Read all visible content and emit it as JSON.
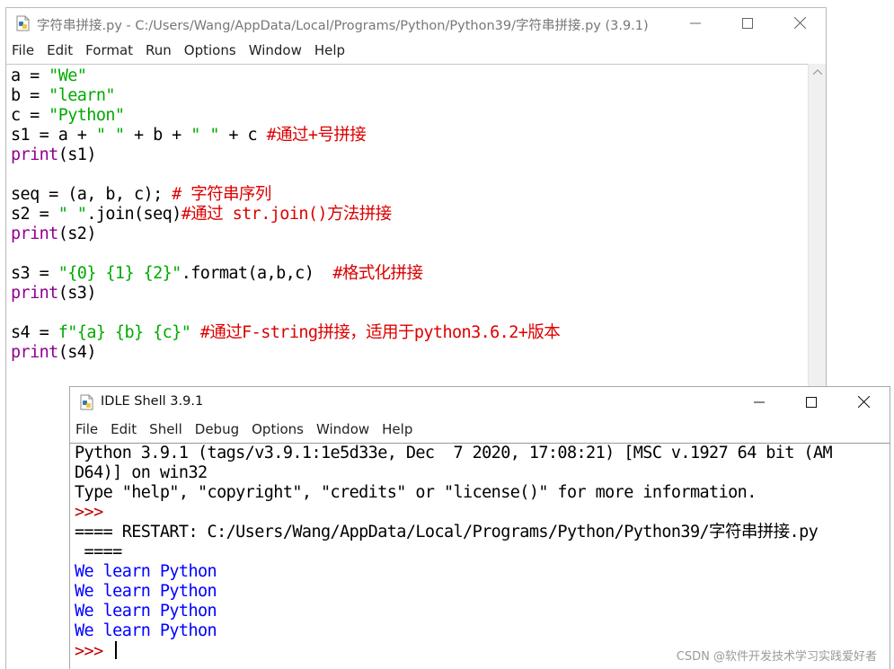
{
  "editor": {
    "title": "字符串拼接.py - C:/Users/Wang/AppData/Local/Programs/Python/Python39/字符串拼接.py (3.9.1)",
    "menu": [
      "File",
      "Edit",
      "Format",
      "Run",
      "Options",
      "Window",
      "Help"
    ],
    "lines": [
      [
        {
          "t": "a = ",
          "c": "plain"
        },
        {
          "t": "\"We\"",
          "c": "string"
        }
      ],
      [
        {
          "t": "b = ",
          "c": "plain"
        },
        {
          "t": "\"learn\"",
          "c": "string"
        }
      ],
      [
        {
          "t": "c = ",
          "c": "plain"
        },
        {
          "t": "\"Python\"",
          "c": "string"
        }
      ],
      [
        {
          "t": "s1 = a + ",
          "c": "plain"
        },
        {
          "t": "\" \"",
          "c": "string"
        },
        {
          "t": " + b + ",
          "c": "plain"
        },
        {
          "t": "\" \"",
          "c": "string"
        },
        {
          "t": " + c ",
          "c": "plain"
        },
        {
          "t": "#通过+号拼接",
          "c": "comment"
        }
      ],
      [
        {
          "t": "print",
          "c": "keyword"
        },
        {
          "t": "(s1)",
          "c": "plain"
        }
      ],
      [],
      [
        {
          "t": "seq = (a, b, c); ",
          "c": "plain"
        },
        {
          "t": "# 字符串序列",
          "c": "comment"
        }
      ],
      [
        {
          "t": "s2 = ",
          "c": "plain"
        },
        {
          "t": "\" \"",
          "c": "string"
        },
        {
          "t": ".join(seq)",
          "c": "plain"
        },
        {
          "t": "#通过 str.join()方法拼接",
          "c": "comment"
        }
      ],
      [
        {
          "t": "print",
          "c": "keyword"
        },
        {
          "t": "(s2)",
          "c": "plain"
        }
      ],
      [],
      [
        {
          "t": "s3 = ",
          "c": "plain"
        },
        {
          "t": "\"{0} {1} {2}\"",
          "c": "string"
        },
        {
          "t": ".format(a,b,c)  ",
          "c": "plain"
        },
        {
          "t": "#格式化拼接",
          "c": "comment"
        }
      ],
      [
        {
          "t": "print",
          "c": "keyword"
        },
        {
          "t": "(s3)",
          "c": "plain"
        }
      ],
      [],
      [
        {
          "t": "s4 = ",
          "c": "plain"
        },
        {
          "t": "f\"{a} {b} {c}\"",
          "c": "string"
        },
        {
          "t": " ",
          "c": "plain"
        },
        {
          "t": "#通过F-string拼接，适用于python3.6.2+版本",
          "c": "comment"
        }
      ],
      [
        {
          "t": "print",
          "c": "keyword"
        },
        {
          "t": "(s4)",
          "c": "plain"
        }
      ]
    ]
  },
  "shell": {
    "title": "IDLE Shell 3.9.1",
    "menu": [
      "File",
      "Edit",
      "Shell",
      "Debug",
      "Options",
      "Window",
      "Help"
    ],
    "lines": [
      [
        {
          "t": "Python 3.9.1 (tags/v3.9.1:1e5d33e, Dec  7 2020, 17:08:21) [MSC v.1927 64 bit (AM",
          "c": "plain"
        }
      ],
      [
        {
          "t": "D64)] on win32",
          "c": "plain"
        }
      ],
      [
        {
          "t": "Type \"help\", \"copyright\", \"credits\" or \"license()\" for more information.",
          "c": "plain"
        }
      ],
      [
        {
          "t": ">>>",
          "c": "prompt"
        }
      ],
      [
        {
          "t": "==== RESTART: C:/Users/Wang/AppData/Local/Programs/Python/Python39/字符串拼接.py",
          "c": "plain"
        }
      ],
      [
        {
          "t": " ====",
          "c": "plain"
        }
      ],
      [
        {
          "t": "We learn Python",
          "c": "output"
        }
      ],
      [
        {
          "t": "We learn Python",
          "c": "output"
        }
      ],
      [
        {
          "t": "We learn Python",
          "c": "output"
        }
      ],
      [
        {
          "t": "We learn Python",
          "c": "output"
        }
      ],
      [
        {
          "t": ">>> ",
          "c": "prompt"
        }
      ]
    ]
  },
  "watermark": "CSDN @软件开发技术学习实践爱好者",
  "colors": {
    "keyword": "#900090",
    "string": "#00aa00",
    "comment": "#dd0000",
    "output": "#0000ff",
    "prompt": "#c00000"
  },
  "icons": [
    "python-file-icon",
    "minimize-icon",
    "maximize-icon",
    "close-icon",
    "scroll-up-arrow-icon"
  ]
}
